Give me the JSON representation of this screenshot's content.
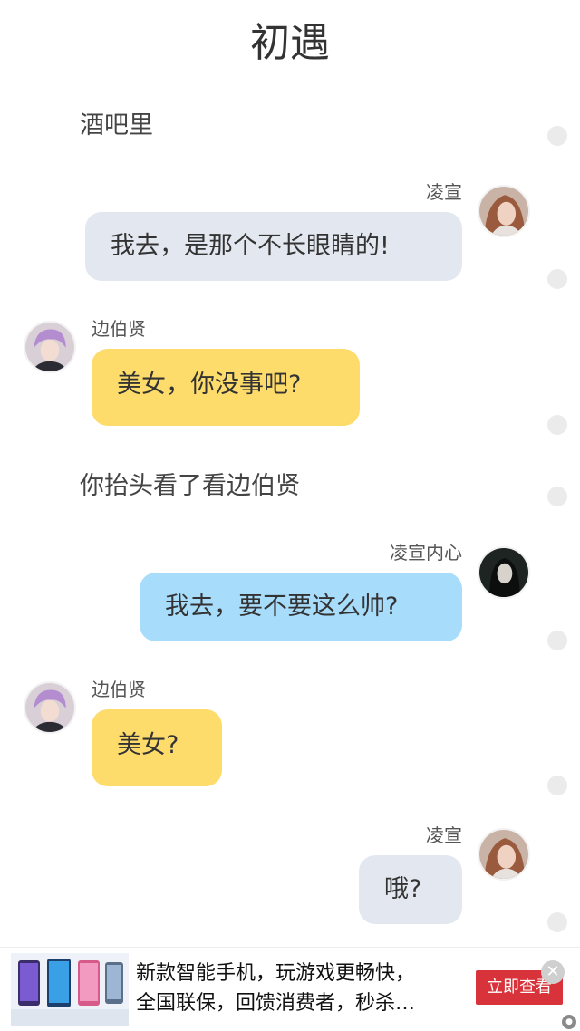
{
  "header": {
    "title": "初遇"
  },
  "colors": {
    "bubble_gray": "#e3e8f0",
    "bubble_yellow": "#fddc6c",
    "bubble_blue": "#a8dcfb",
    "ad_button": "#d8333a"
  },
  "story": {
    "items": [
      {
        "type": "narration",
        "text": "酒吧里"
      },
      {
        "type": "message",
        "side": "right",
        "name": "凌宣",
        "text": "我去，是那个不长眼睛的!",
        "bubble": "gray",
        "avatar": "girl-portrait-avatar"
      },
      {
        "type": "message",
        "side": "left",
        "name": "边伯贤",
        "text": "美女，你没事吧?",
        "bubble": "yellow",
        "avatar": "boy-portrait-avatar"
      },
      {
        "type": "narration",
        "text": "你抬头看了看边伯贤"
      },
      {
        "type": "message",
        "side": "right",
        "name": "凌宣内心",
        "text": "我去，要不要这么帅?",
        "bubble": "blue",
        "avatar": "dark-girl-avatar"
      },
      {
        "type": "message",
        "side": "left",
        "name": "边伯贤",
        "text": "美女?",
        "bubble": "yellow",
        "avatar": "boy-portrait-avatar"
      },
      {
        "type": "message",
        "side": "right",
        "name": "凌宣",
        "text": "哦?",
        "bubble": "gray",
        "avatar": "girl-portrait-avatar"
      }
    ]
  },
  "ad": {
    "line1": "新款智能手机，玩游戏更畅快，",
    "line2": "全国联保，回馈消费者，秒杀…",
    "button_label": "立即查看",
    "close_icon": "close-icon"
  }
}
